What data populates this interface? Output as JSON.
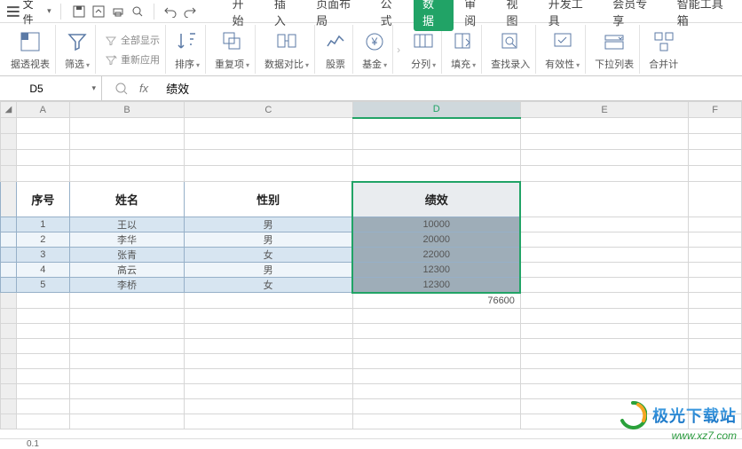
{
  "topbar": {
    "file_label": "文件",
    "tabs": [
      "开始",
      "插入",
      "页面布局",
      "公式",
      "数据",
      "审阅",
      "视图",
      "开发工具",
      "会员专享",
      "智能工具箱"
    ],
    "active_tab_index": 4
  },
  "ribbon": {
    "pivot": "据透视表",
    "filter": "筛选",
    "show_all": "全部显示",
    "reapply": "重新应用",
    "sort": "排序",
    "dedup": "重复项",
    "compare": "数据对比",
    "stock": "股票",
    "fund": "基金",
    "split": "分列",
    "fill": "填充",
    "lookup": "查找录入",
    "validate": "有效性",
    "dropdown": "下拉列表",
    "consolidate": "合并计"
  },
  "formula_bar": {
    "cell_ref": "D5",
    "value": "绩效"
  },
  "grid": {
    "col_labels": [
      "A",
      "B",
      "C",
      "D",
      "E",
      "F"
    ],
    "active_col_index": 3,
    "header_row": [
      "序号",
      "姓名",
      "性别",
      "绩效"
    ],
    "rows": [
      {
        "seq": "1",
        "name": "王以",
        "gender": "男",
        "score": "10000"
      },
      {
        "seq": "2",
        "name": "李华",
        "gender": "男",
        "score": "20000"
      },
      {
        "seq": "3",
        "name": "张青",
        "gender": "女",
        "score": "22000"
      },
      {
        "seq": "4",
        "name": "高云",
        "gender": "男",
        "score": "12300"
      },
      {
        "seq": "5",
        "name": "李桥",
        "gender": "女",
        "score": "12300"
      }
    ],
    "sum": "76600",
    "status_value": "0.1"
  },
  "watermark": {
    "text": "极光下载站",
    "url": "www.xz7.com"
  }
}
